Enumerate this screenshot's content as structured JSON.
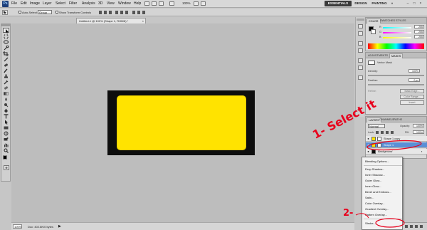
{
  "menubar": {
    "logo": "Ps",
    "items": [
      "File",
      "Edit",
      "Image",
      "Layer",
      "Select",
      "Filter",
      "Analysis",
      "3D",
      "View",
      "Window",
      "Help"
    ],
    "zoom": "100%",
    "workspaces": [
      "ESSENTIALS",
      "DESIGN",
      "PAINTING"
    ],
    "overflow": "»",
    "window_controls": [
      "–",
      "□",
      "×"
    ]
  },
  "options": {
    "auto_select_label": "Auto-Select:",
    "auto_select_value": "Group",
    "transform_label": "Show Transform Controls"
  },
  "document": {
    "tab_title": "Untitled-1 @ 100% (Shape 1, RGB/8) *",
    "tab_close": "×",
    "canvas_color": "#0d0d0d",
    "shape_color": "#ffe300"
  },
  "statusbar": {
    "zoom": "100%",
    "doc_info": "Doc: 402.8K/0 bytes"
  },
  "panels": {
    "color_tabs": [
      "COLOR",
      "SWATCHES",
      "STYLES"
    ],
    "color_channels": [
      {
        "label": "R",
        "value": "255"
      },
      {
        "label": "G",
        "value": "255"
      },
      {
        "label": "B",
        "value": "255"
      }
    ],
    "adjust_tabs": [
      "ADJUSTMENTS",
      "MASKS"
    ],
    "mask_title": "Vector Mask",
    "density_label": "Density:",
    "density_value": "100%",
    "feather_label": "Feather:",
    "feather_value": "0 px",
    "refine_label": "Refine:",
    "mask_edge": "Mask Edge...",
    "color_range": "Color Range...",
    "invert": "Invert",
    "layers_tabs": [
      "LAYERS",
      "CHANNELS",
      "PATHS"
    ],
    "blend_mode": "Normal",
    "opacity_label": "Opacity:",
    "opacity_value": "100%",
    "lock_label": "Lock:",
    "fill_label": "Fill:",
    "fill_value": "100%",
    "layers": [
      {
        "name": "Shape 1 copy",
        "selected": false
      },
      {
        "name": "Shape 1",
        "selected": true
      },
      {
        "name": "Background",
        "selected": false
      }
    ]
  },
  "context_menu": {
    "items": [
      "Blending Options...",
      "Drop Shadow...",
      "Inner Shadow...",
      "Outer Glow...",
      "Inner Glow...",
      "Bevel and Emboss...",
      "Satin...",
      "Color Overlay...",
      "Gradient Overlay...",
      "Pattern Overlay...",
      "Stroke..."
    ]
  },
  "annotations": {
    "step1": "1- Select it",
    "step2": "2-",
    "color": "#e8001c"
  }
}
